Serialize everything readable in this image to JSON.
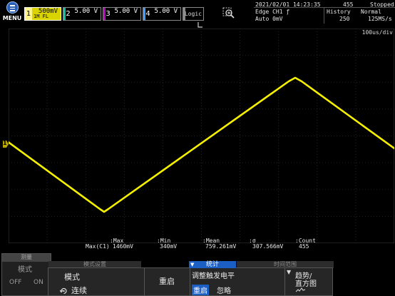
{
  "menu_label": "MENU",
  "channels": [
    {
      "number": "1",
      "value": "500mV",
      "marker": "1M FL",
      "color": "#d9d300"
    },
    {
      "number": "2",
      "value": "5.00 V",
      "color": "#00c8a0"
    },
    {
      "number": "3",
      "value": "5.00 V",
      "color": "#c000c0"
    },
    {
      "number": "4",
      "value": "5.00 V",
      "color": "#3a9cff"
    }
  ],
  "logic_label": "Logic",
  "status": {
    "datetime": "2021/02/01 14:23:35",
    "acq_count": "455",
    "state": "Stopped",
    "trigger": "Edge CH1 ƒ",
    "trigger_mode": "Auto 0mV",
    "history_label": "History",
    "history_value": "250",
    "acq_mode": "Normal",
    "sample_rate": "125MS/s",
    "time_div": "100us/div"
  },
  "trigger_level_marker": "1",
  "waveform_color": "#f5f000",
  "measurements": [
    {
      "header": ":Max",
      "source": "Max(C1)",
      "value": "1460mV"
    },
    {
      "header": ":Min",
      "value": "340mV"
    },
    {
      "header": ":Mean",
      "value": "759.261mV"
    },
    {
      "header": ":σ",
      "value": "307.566mV"
    },
    {
      "header": ":Count",
      "value": "455"
    }
  ],
  "bottom_menu": {
    "measure_tab": "测量",
    "mode_small_label": "模式",
    "off_label": "OFF",
    "on_label": "ON",
    "faded_tab_1": "模式设置",
    "mode_label": "模式",
    "mode_value": "连续",
    "stats_tab": "统计",
    "reset_button": "重启",
    "adjust_trigger_label": "调整触发电平",
    "adjust_on": "重启",
    "adjust_off": "忽略",
    "faded_tab_2": "时间范围",
    "trend_label_1": "趋势/",
    "trend_label_2": "直方图"
  }
}
